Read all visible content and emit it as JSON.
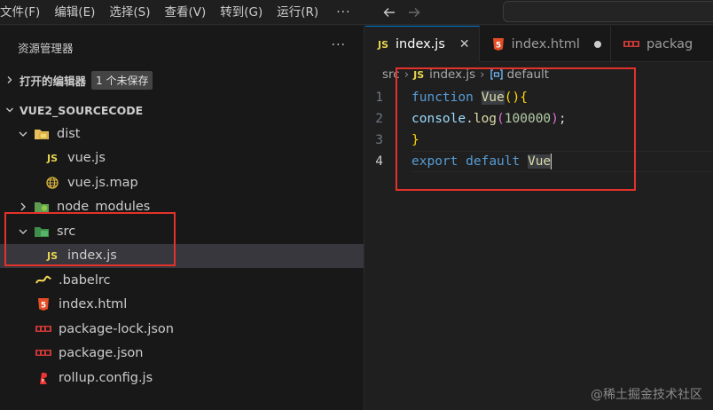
{
  "menu": {
    "items": [
      "文件(F)",
      "编辑(E)",
      "选择(S)",
      "查看(V)",
      "转到(G)",
      "运行(R)"
    ],
    "more": "···"
  },
  "explorer": {
    "title": "资源管理器",
    "more": "···",
    "open_editors_label": "打开的编辑器",
    "unsaved_badge": "1 个未保存",
    "root_label": "VUE2_SOURCECODE",
    "tree": [
      {
        "label": "dist",
        "icon": "folder-dist-icon",
        "expanded": true
      },
      {
        "label": "vue.js",
        "icon": "js-file-icon"
      },
      {
        "label": "vue.js.map",
        "icon": "globe-map-icon"
      },
      {
        "label": "node_modules",
        "icon": "folder-node-icon",
        "expanded": false
      },
      {
        "label": "src",
        "icon": "folder-src-icon",
        "expanded": true
      },
      {
        "label": "index.js",
        "icon": "js-file-icon",
        "selected": true
      },
      {
        "label": ".babelrc",
        "icon": "babel-icon"
      },
      {
        "label": "index.html",
        "icon": "html5-icon"
      },
      {
        "label": "package-lock.json",
        "icon": "npm-icon"
      },
      {
        "label": "package.json",
        "icon": "npm-icon"
      },
      {
        "label": "rollup.config.js",
        "icon": "rollup-icon"
      }
    ]
  },
  "tabs": [
    {
      "label": "index.js",
      "icon_text": "JS",
      "active": true
    },
    {
      "label": "index.html",
      "icon_text": "5",
      "modified": true
    },
    {
      "label": "packag",
      "icon_text": "npm"
    }
  ],
  "breadcrumb": {
    "folder": "src",
    "file_icon": "JS",
    "file": "index.js",
    "symbol": "default"
  },
  "code": {
    "line_numbers": [
      "1",
      "2",
      "3",
      "4"
    ],
    "l1_kw": "function",
    "l1_name": "Vue",
    "l1_parens": "()",
    "l1_brace": "{",
    "l2_obj": "console",
    "l2_dot": ".",
    "l2_fn": "log",
    "l2_open": "(",
    "l2_num": "100000",
    "l2_close": ")",
    "l2_semi": ";",
    "l3_brace": "}",
    "l4_kw1": "export",
    "l4_kw2": "default",
    "l4_name": "Vue"
  },
  "watermark": "@稀土掘金技术社区",
  "colors": {
    "highlight_box": "#e5312b",
    "accent": "#0078d4"
  }
}
